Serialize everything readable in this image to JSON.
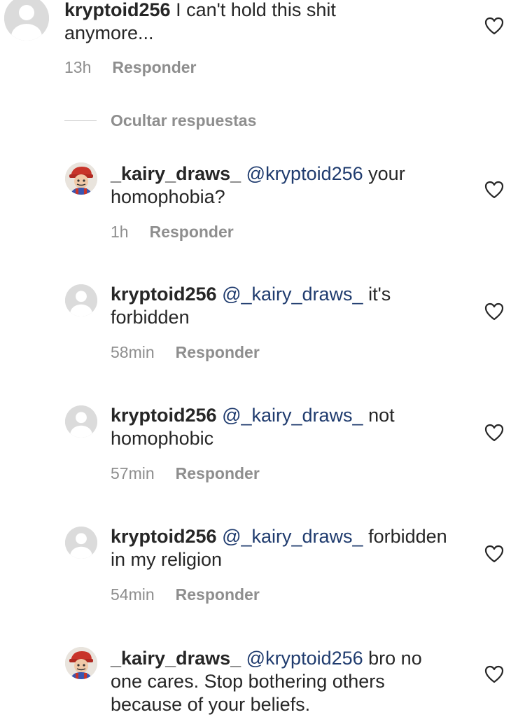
{
  "comments": [
    {
      "username": "kryptoid256",
      "mention": "",
      "text_after": " I can't hold this shit anymore...",
      "time": "13h",
      "reply_label": "Responder",
      "avatar": "default"
    },
    {
      "username": "_kairy_draws_",
      "mention": "@kryptoid256",
      "text_after": " your homophobia?",
      "time": "1h",
      "reply_label": "Responder",
      "avatar": "art"
    },
    {
      "username": "kryptoid256",
      "mention": "@_kairy_draws_",
      "text_after": " it's forbidden",
      "time": "58min",
      "reply_label": "Responder",
      "avatar": "default"
    },
    {
      "username": "kryptoid256",
      "mention": "@_kairy_draws_",
      "text_after": " not homophobic",
      "time": "57min",
      "reply_label": "Responder",
      "avatar": "default"
    },
    {
      "username": "kryptoid256",
      "mention": "@_kairy_draws_",
      "text_after": " forbidden in my religion",
      "time": "54min",
      "reply_label": "Responder",
      "avatar": "default"
    },
    {
      "username": "_kairy_draws_",
      "mention": "@kryptoid256",
      "text_after": " bro no one cares. Stop bothering others because of your beliefs.",
      "time": "",
      "reply_label": "",
      "avatar": "art"
    }
  ],
  "replies_toggle": {
    "label": "Ocultar respuestas"
  },
  "colors": {
    "text": "#262626",
    "mention": "#1f3b6e",
    "meta": "#8e8e8e",
    "avatar_placeholder": "#dbdbdb"
  },
  "icons": {
    "like": "heart-outline-icon",
    "avatar_default": "default-avatar-icon"
  }
}
